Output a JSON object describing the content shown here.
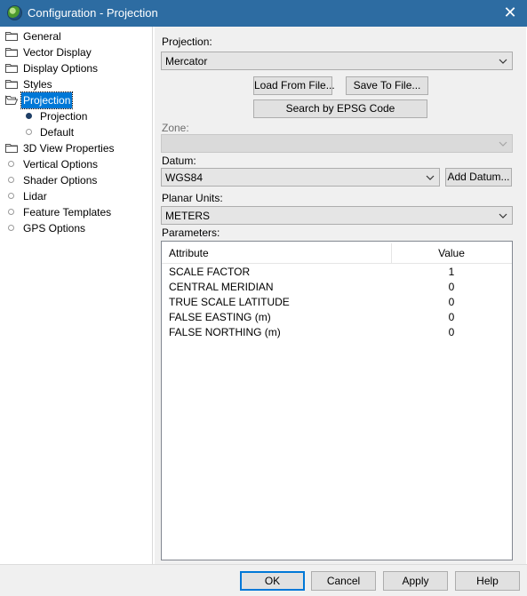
{
  "window": {
    "title": "Configuration - Projection",
    "close_glyph": "✕",
    "accent_color": "#2d6ca2"
  },
  "tree": {
    "items": [
      {
        "label": "General",
        "icon": "folder-icon"
      },
      {
        "label": "Vector Display",
        "icon": "folder-icon"
      },
      {
        "label": "Display Options",
        "icon": "folder-icon"
      },
      {
        "label": "Styles",
        "icon": "folder-icon"
      },
      {
        "label": "Projection",
        "icon": "folder-open-icon",
        "selected": true
      },
      {
        "label": "Projection",
        "icon": "bullet-filled-icon"
      },
      {
        "label": "Default",
        "icon": "bullet-icon"
      },
      {
        "label": "3D View Properties",
        "icon": "folder-icon"
      },
      {
        "label": "Vertical Options",
        "icon": "bullet-icon"
      },
      {
        "label": "Shader Options",
        "icon": "bullet-icon"
      },
      {
        "label": "Lidar",
        "icon": "bullet-icon"
      },
      {
        "label": "Feature Templates",
        "icon": "bullet-icon"
      },
      {
        "label": "GPS Options",
        "icon": "bullet-icon"
      }
    ]
  },
  "projection": {
    "label": "Projection:",
    "value": "Mercator",
    "load_button": "Load From File...",
    "save_button": "Save To File...",
    "epsg_button": "Search by EPSG Code"
  },
  "zone": {
    "label": "Zone:",
    "value": ""
  },
  "datum": {
    "label": "Datum:",
    "value": "WGS84",
    "add_button": "Add Datum..."
  },
  "planar_units": {
    "label": "Planar Units:",
    "value": "METERS"
  },
  "parameters": {
    "label": "Parameters:",
    "columns": [
      "Attribute",
      "Value"
    ],
    "rows": [
      {
        "attribute": "SCALE FACTOR",
        "value": "1"
      },
      {
        "attribute": "CENTRAL MERIDIAN",
        "value": "0"
      },
      {
        "attribute": "TRUE SCALE LATITUDE",
        "value": "0"
      },
      {
        "attribute": "FALSE EASTING (m)",
        "value": "0"
      },
      {
        "attribute": "FALSE NORTHING (m)",
        "value": "0"
      }
    ]
  },
  "buttons": {
    "ok": "OK",
    "cancel": "Cancel",
    "apply": "Apply",
    "help": "Help"
  }
}
